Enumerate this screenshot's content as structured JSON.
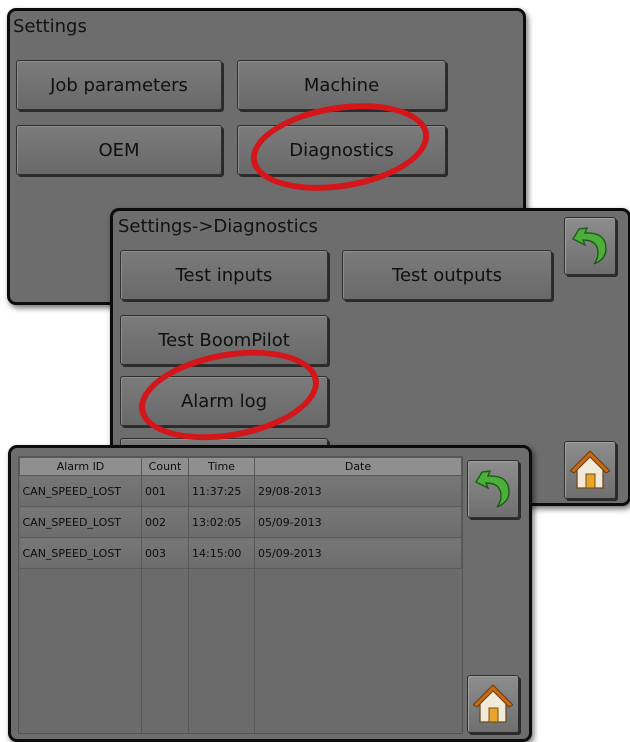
{
  "settings_panel": {
    "title": "Settings",
    "buttons": [
      "Job parameters",
      "Machine",
      "OEM",
      "Diagnostics"
    ]
  },
  "diagnostics_panel": {
    "title": "Settings->Diagnostics",
    "buttons": [
      "Test inputs",
      "Test outputs",
      "Test BoomPilot",
      "Alarm log"
    ]
  },
  "alarm_log_panel": {
    "columns": [
      "Alarm ID",
      "Count",
      "Time",
      "Date"
    ],
    "rows": [
      [
        "CAN_SPEED_LOST",
        "001",
        "11:37:25",
        "29/08-2013"
      ],
      [
        "CAN_SPEED_LOST",
        "002",
        "13:02:05",
        "05/09-2013"
      ],
      [
        "CAN_SPEED_LOST",
        "003",
        "14:15:00",
        "05/09-2013"
      ]
    ]
  },
  "icons": {
    "back": "back-arrow-icon",
    "home": "home-icon"
  },
  "colors": {
    "panel_bg": "#6d6d6d",
    "highlight_ring": "#d4151a",
    "back_arrow": "#4caf3a",
    "home_roof": "#c76a18"
  }
}
